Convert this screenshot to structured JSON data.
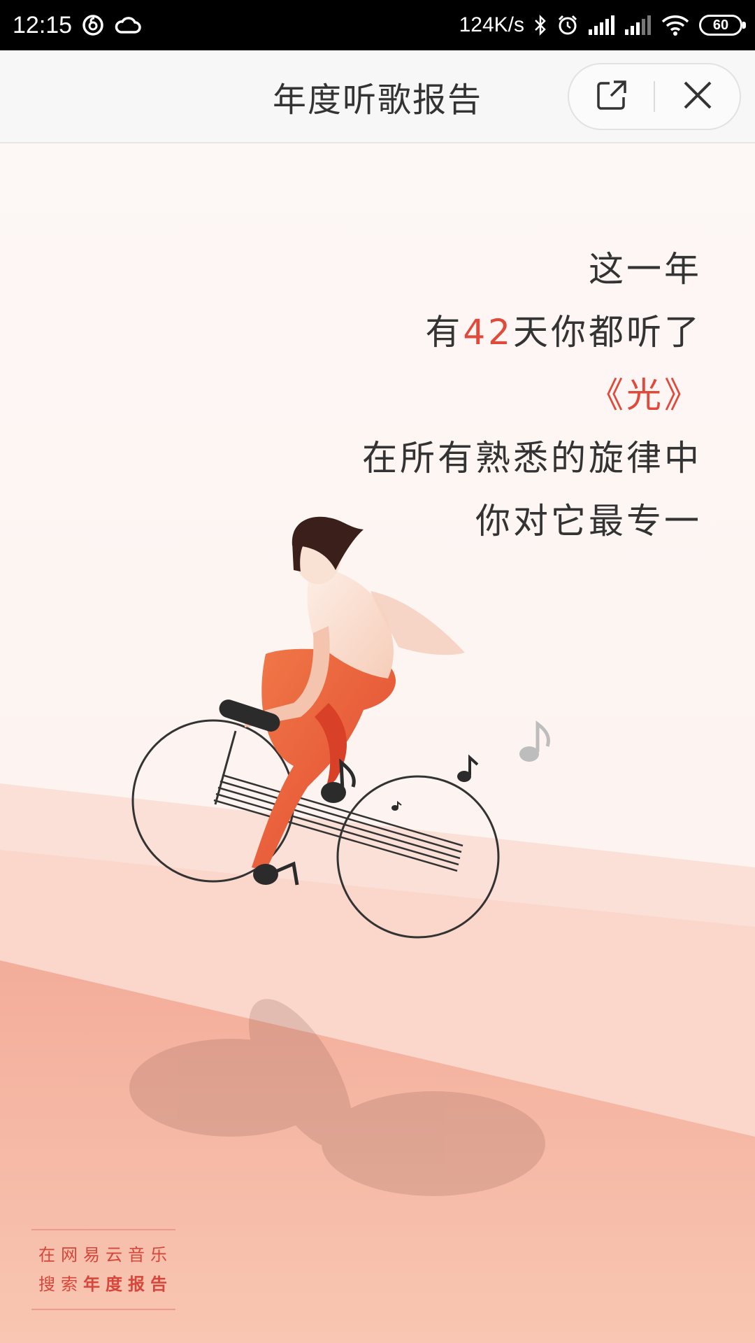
{
  "status_bar": {
    "time": "12:15",
    "net_speed": "124K/s",
    "battery": "60",
    "icons": [
      "netease-music-icon",
      "cloud-icon",
      "bluetooth-icon",
      "alarm-icon",
      "signal-icon",
      "signal-icon",
      "wifi-icon",
      "battery-icon"
    ]
  },
  "nav": {
    "title": "年度听歌报告",
    "share_icon": "share-icon",
    "close_icon": "close-icon"
  },
  "report": {
    "line1": "这一年",
    "line2_prefix": "有",
    "days": "42",
    "line2_suffix": "天你都听了",
    "song": "《光》",
    "line4": "在所有熟悉的旋律中",
    "line5": "你对它最专一"
  },
  "promo": {
    "line1": "在网易云音乐",
    "line2_prefix": "搜索",
    "line2_strong": "年度报告"
  },
  "colors": {
    "accent": "#e04a3a",
    "background": "#fdf6f4",
    "slope_light": "#fbd8cf",
    "slope_dark": "#f2ab98"
  }
}
